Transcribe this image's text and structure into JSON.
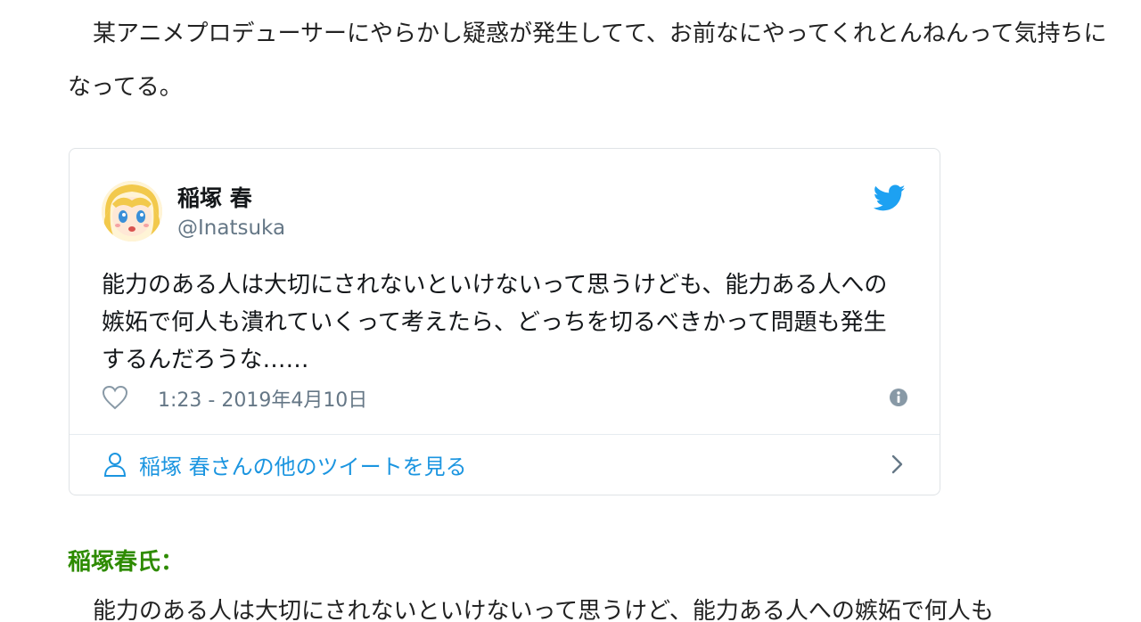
{
  "article": {
    "intro_paragraph": "某アニメプロデューサーにやらかし疑惑が発生してて、お前なにやってくれとんねんって気持ちになってる。",
    "speaker_heading": "稲塚春氏：",
    "quote_paragraph": "能力のある人は大切にされないといけないって思うけど、能力ある人への嫉妬で何人も"
  },
  "tweet": {
    "author_name": "稲塚 春",
    "author_handle": "@Inatsuka",
    "text": "能力のある人は大切にされないといけないって思うけども、能力ある人への嫉妬で何人も潰れていくって考えたら、どっちを切るべきかって問題も発生するんだろうな……",
    "timestamp": "1:23 - 2019年4月10日",
    "more_tweets_label": "稲塚 春さんの他のツイートを見る"
  },
  "colors": {
    "twitter_blue": "#1da1f2",
    "link_blue": "#1b95e0",
    "meta_gray": "#657786",
    "heading_green": "#2e8b00"
  },
  "icons": {
    "brand": "twitter-bird-icon",
    "like": "heart-icon",
    "info": "info-icon",
    "profile": "person-icon",
    "more": "chevron-right-icon"
  }
}
